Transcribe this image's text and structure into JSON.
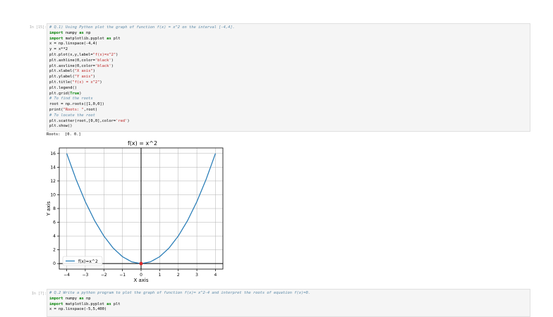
{
  "cells": [
    {
      "prompt": "In [15]:",
      "lines": [
        [
          [
            "c",
            "# Q.1) Using Python plot the graph of function f(x) = x^2 on the interval [-4,4]."
          ]
        ],
        [
          [
            "k",
            "import"
          ],
          [
            "t",
            " numpy "
          ],
          [
            "k",
            "as"
          ],
          [
            "t",
            " np"
          ]
        ],
        [
          [
            "k",
            "import"
          ],
          [
            "t",
            " matplotlib.pyplot "
          ],
          [
            "k",
            "as"
          ],
          [
            "t",
            " plt"
          ]
        ],
        [
          [
            "t",
            "x = np.linspace(-4,4)"
          ]
        ],
        [
          [
            "t",
            "y = x**2"
          ]
        ],
        [
          [
            "t",
            "plt.plot(x,y,label="
          ],
          [
            "s",
            "\"f(x)=x^2\""
          ],
          [
            "t",
            ")"
          ]
        ],
        [
          [
            "t",
            "plt.axhline(0,color="
          ],
          [
            "s",
            "'black'"
          ],
          [
            "t",
            ")"
          ]
        ],
        [
          [
            "t",
            "plt.axvline(0,color="
          ],
          [
            "s",
            "'black'"
          ],
          [
            "t",
            ")"
          ]
        ],
        [
          [
            "t",
            "plt.xlabel("
          ],
          [
            "s",
            "\"X axis\""
          ],
          [
            "t",
            ")"
          ]
        ],
        [
          [
            "t",
            "plt.ylabel("
          ],
          [
            "s",
            "\"Y axis\""
          ],
          [
            "t",
            ")"
          ]
        ],
        [
          [
            "t",
            "plt.title("
          ],
          [
            "s",
            "\"f(x) = x^2\""
          ],
          [
            "t",
            ")"
          ]
        ],
        [
          [
            "t",
            "plt.legend()"
          ]
        ],
        [
          [
            "t",
            "plt.grid("
          ],
          [
            "k",
            "True"
          ],
          [
            "t",
            ")"
          ]
        ],
        [
          [
            "c",
            "# To find the roots"
          ]
        ],
        [
          [
            "t",
            "root = np.roots([1,0,0])"
          ]
        ],
        [
          [
            "t",
            "print("
          ],
          [
            "s",
            "\"Roots: \""
          ],
          [
            "t",
            ",root)"
          ]
        ],
        [
          [
            "c",
            "# To locate the root"
          ]
        ],
        [
          [
            "t",
            "plt.scatter(root,[0,0],color="
          ],
          [
            "s",
            "'red'"
          ],
          [
            "t",
            ")"
          ]
        ],
        [
          [
            "t",
            "plt.show()"
          ]
        ]
      ]
    },
    {
      "prompt": "In [7]:",
      "lines": [
        [
          [
            "c",
            "# Q.2 Write a python program to plot the graph of function f(x)= x^2-4 and interpret the roots of equation f(x)=0."
          ]
        ],
        [
          [
            "k",
            "import"
          ],
          [
            "t",
            " numpy "
          ],
          [
            "k",
            "as"
          ],
          [
            "t",
            " np"
          ]
        ],
        [
          [
            "k",
            "import"
          ],
          [
            "t",
            " matplotlib.pyplot "
          ],
          [
            "k",
            "as"
          ],
          [
            "t",
            " plt"
          ]
        ],
        [
          [
            "t",
            "x = np.linspace(-5,5,400)"
          ]
        ]
      ]
    }
  ],
  "output_text": "Roots:  [0. 0.]",
  "colors": {
    "line": "#1f77b4",
    "root_marker": "#d62728",
    "axis_line": "#000000",
    "grid": "#b0b0b0"
  },
  "chart_data": {
    "type": "line",
    "title": "f(x) = x^2",
    "xlabel": "X axis",
    "ylabel": "Y axis",
    "xlim": [
      -4.4,
      4.4
    ],
    "ylim": [
      -0.8,
      16.8
    ],
    "xticks": [
      -4,
      -3,
      -2,
      -1,
      0,
      1,
      2,
      3,
      4
    ],
    "yticks": [
      0,
      2,
      4,
      6,
      8,
      10,
      12,
      14,
      16
    ],
    "xtick_labels": [
      "−4",
      "−3",
      "−2",
      "−1",
      "0",
      "1",
      "2",
      "3",
      "4"
    ],
    "ytick_labels": [
      "0",
      "2",
      "4",
      "6",
      "8",
      "10",
      "12",
      "14",
      "16"
    ],
    "grid": true,
    "legend_position": "lower-left",
    "series": [
      {
        "name": "f(x)=x^2",
        "x": [
          -4,
          -3.5,
          -3,
          -2.5,
          -2,
          -1.5,
          -1,
          -0.5,
          0,
          0.5,
          1,
          1.5,
          2,
          2.5,
          3,
          3.5,
          4
        ],
        "y": [
          16,
          12.25,
          9,
          6.25,
          4,
          2.25,
          1,
          0.25,
          0,
          0.25,
          1,
          2.25,
          4,
          6.25,
          9,
          12.25,
          16
        ]
      }
    ],
    "scatter": {
      "x": [
        0,
        0
      ],
      "y": [
        0,
        0
      ]
    }
  }
}
